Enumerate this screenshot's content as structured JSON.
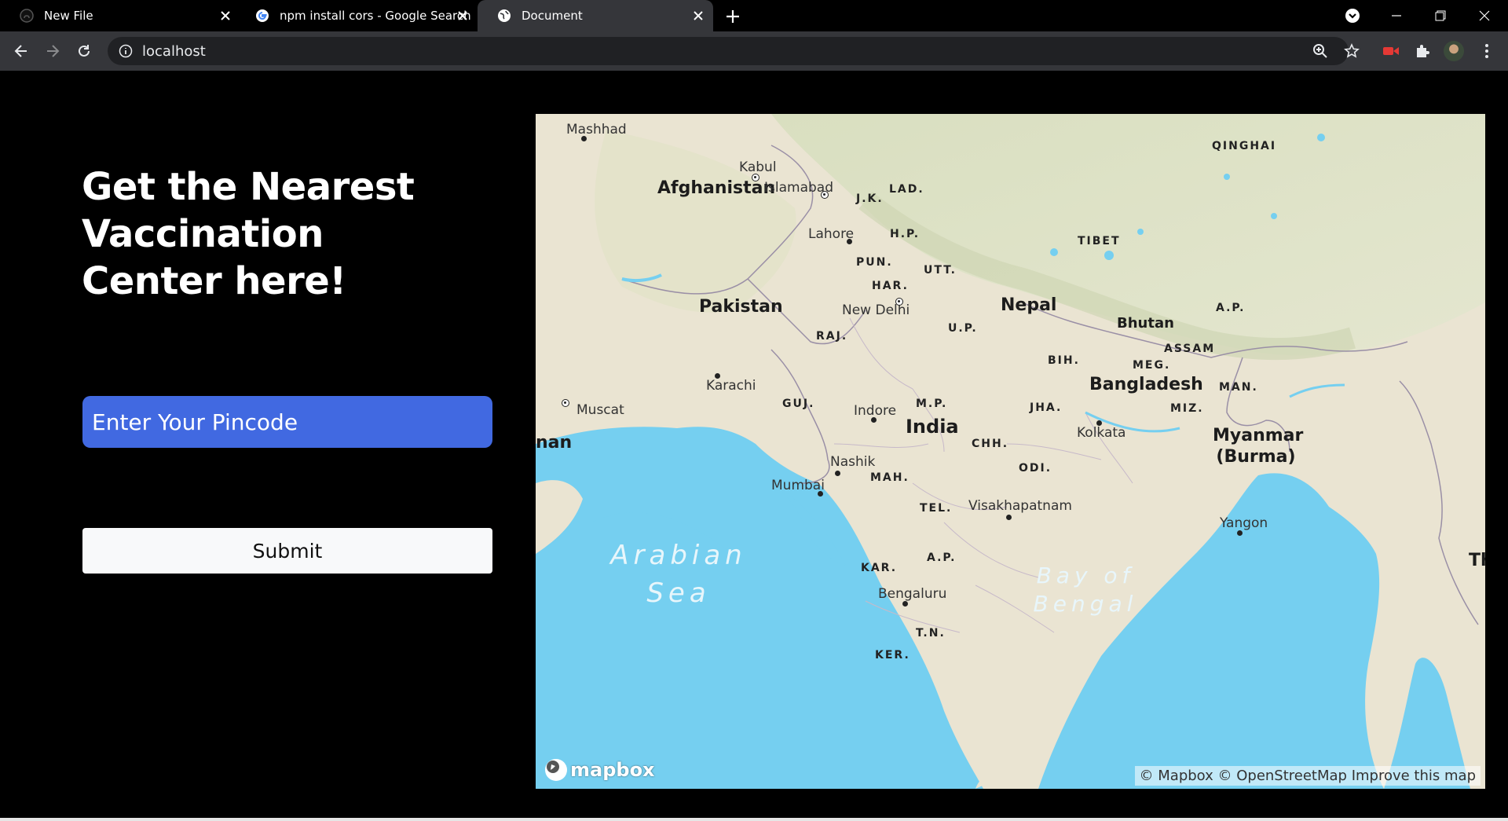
{
  "browser": {
    "tabs": [
      {
        "title": "New File",
        "favicon": "github-icon"
      },
      {
        "title": "npm install cors - Google Search",
        "favicon": "google-icon"
      },
      {
        "title": "Document",
        "favicon": "globe-icon",
        "active": true
      }
    ],
    "url": "localhost"
  },
  "page": {
    "heading": "Get the Nearest Vaccination Center here!",
    "pincode_placeholder": "Enter Your Pincode",
    "pincode_value": "",
    "submit_label": "Submit"
  },
  "map": {
    "countries": [
      "Afghanistan",
      "Pakistan",
      "Nepal",
      "Bhutan",
      "Bangladesh",
      "India",
      "Myanmar (Burma)"
    ],
    "regions": [
      "QINGHAI",
      "TIBET",
      "J.K.",
      "LAD.",
      "H.P.",
      "PUN.",
      "UTT.",
      "HAR.",
      "RAJ.",
      "U.P.",
      "A.P.",
      "ASSAM",
      "MEG.",
      "BIH.",
      "MAN.",
      "GUJ.",
      "M.P.",
      "JHA.",
      "MIZ.",
      "CHH.",
      "MAH.",
      "ODI.",
      "TEL.",
      "KAR.",
      "A.P.",
      "T.N.",
      "KER."
    ],
    "cities": [
      "Mashhad",
      "Kabul",
      "Islamabad",
      "Lahore",
      "New Delhi",
      "Karachi",
      "Muscat",
      "Indore",
      "Kolkata",
      "Nashik",
      "Mumbai",
      "Visakhapatnam",
      "Yangon",
      "Bengaluru"
    ],
    "seas": [
      "Arabian Sea",
      "Bay of Bengal"
    ],
    "edge_labels": [
      "nan",
      "Th"
    ],
    "logo_text": "mapbox",
    "attribution": "© Mapbox © OpenStreetMap Improve this map"
  },
  "colors": {
    "input_bg": "#4169e1",
    "water": "#75cff0",
    "land": "#eae4d2"
  }
}
